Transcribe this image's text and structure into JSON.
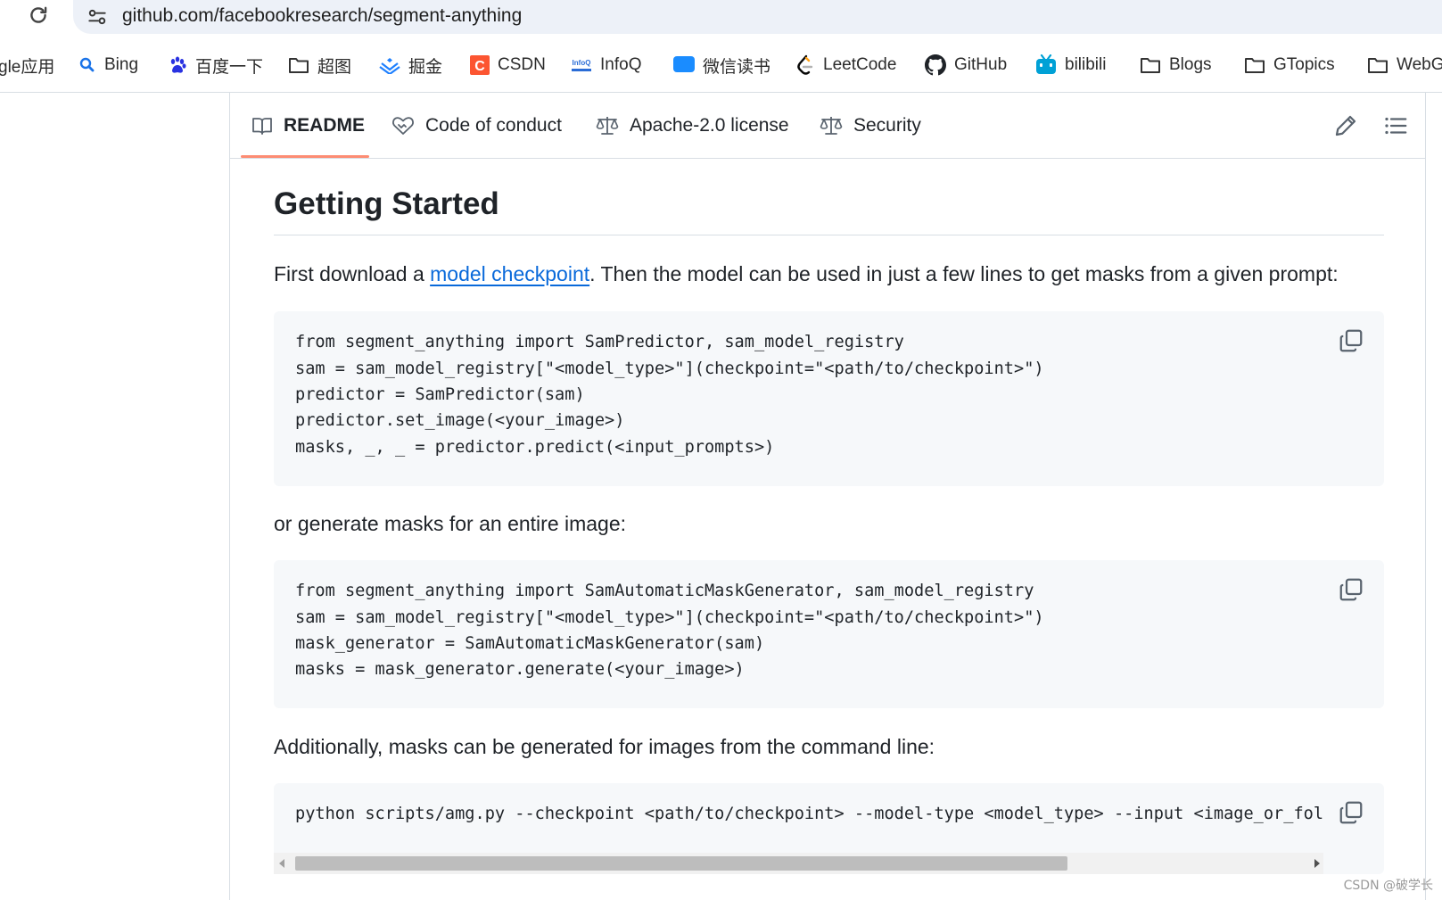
{
  "browser": {
    "url": "github.com/facebookresearch/segment-anything"
  },
  "bookmarks": [
    {
      "label": "gle应用",
      "icon": "apps-icon"
    },
    {
      "label": "Bing",
      "icon": "search-icon"
    },
    {
      "label": "百度一下",
      "icon": "baidu-paw-icon"
    },
    {
      "label": "超图",
      "icon": "folder-icon"
    },
    {
      "label": "掘金",
      "icon": "juejin-icon"
    },
    {
      "label": "CSDN",
      "icon": "csdn-icon"
    },
    {
      "label": "InfoQ",
      "icon": "infoq-icon"
    },
    {
      "label": "微信读书",
      "icon": "weread-icon"
    },
    {
      "label": "LeetCode",
      "icon": "leetcode-icon"
    },
    {
      "label": "GitHub",
      "icon": "github-icon"
    },
    {
      "label": "bilibili",
      "icon": "bilibili-icon"
    },
    {
      "label": "Blogs",
      "icon": "folder-icon"
    },
    {
      "label": "GTopics",
      "icon": "folder-icon"
    },
    {
      "label": "WebG",
      "icon": "folder-icon"
    }
  ],
  "readme_tabs": [
    {
      "label": "README",
      "icon": "book-icon",
      "active": true
    },
    {
      "label": "Code of conduct",
      "icon": "heart-handshake-icon",
      "active": false
    },
    {
      "label": "Apache-2.0 license",
      "icon": "law-scale-icon",
      "active": false
    },
    {
      "label": "Security",
      "icon": "law-scale-icon",
      "active": false
    }
  ],
  "content": {
    "heading": "Getting Started",
    "intro_before_link": "First download a ",
    "intro_link": "model checkpoint",
    "intro_after_link": ". Then the model can be used in just a few lines to get masks from a given prompt:",
    "code1": [
      "from segment_anything import SamPredictor, sam_model_registry",
      "sam = sam_model_registry[\"<model_type>\"](checkpoint=\"<path/to/checkpoint>\")",
      "predictor = SamPredictor(sam)",
      "predictor.set_image(<your_image>)",
      "masks, _, _ = predictor.predict(<input_prompts>)"
    ],
    "para2": "or generate masks for an entire image:",
    "code2": [
      "from segment_anything import SamAutomaticMaskGenerator, sam_model_registry",
      "sam = sam_model_registry[\"<model_type>\"](checkpoint=\"<path/to/checkpoint>\")",
      "mask_generator = SamAutomaticMaskGenerator(sam)",
      "masks = mask_generator.generate(<your_image>)"
    ],
    "para3": "Additionally, masks can be generated for images from the command line:",
    "code3": [
      "python scripts/amg.py --checkpoint <path/to/checkpoint> --model-type <model_type> --input <image_or_fol"
    ]
  },
  "watermark": "CSDN @破学长",
  "colors": {
    "link": "#0969da",
    "tab_underline": "#fd8c73",
    "code_bg": "#f6f8fa",
    "url_bar_bg": "#edf1f8"
  }
}
